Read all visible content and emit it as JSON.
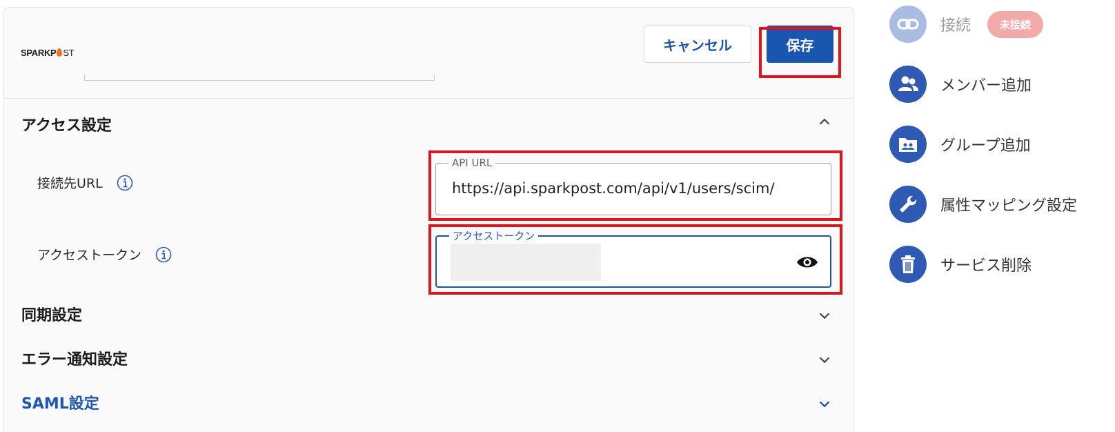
{
  "header": {
    "logo_text_bold": "SPARKP",
    "logo_text_thin": "ST",
    "cancel_label": "キャンセル",
    "save_label": "保存"
  },
  "access_settings": {
    "title": "アクセス設定",
    "url_label": "接続先URL",
    "token_label": "アクセストークン",
    "api_url_field_label": "API URL",
    "api_url_value": "https://api.sparkpost.com/api/v1/users/scim/",
    "token_field_label": "アクセストークン"
  },
  "sections": [
    {
      "title": "同期設定"
    },
    {
      "title": "エラー通知設定"
    },
    {
      "title": "SAML設定"
    }
  ],
  "sidebar": {
    "items": [
      {
        "label": "接続",
        "icon": "link-icon",
        "badge": "未接続"
      },
      {
        "label": "メンバー追加",
        "icon": "users-icon"
      },
      {
        "label": "グループ追加",
        "icon": "group-folder-icon"
      },
      {
        "label": "属性マッピング設定",
        "icon": "wrench-icon"
      },
      {
        "label": "サービス削除",
        "icon": "trash-icon"
      }
    ]
  },
  "colors": {
    "primary": "#1a55b0",
    "highlight": "#e1141c",
    "badge": "#f1a9a9"
  }
}
